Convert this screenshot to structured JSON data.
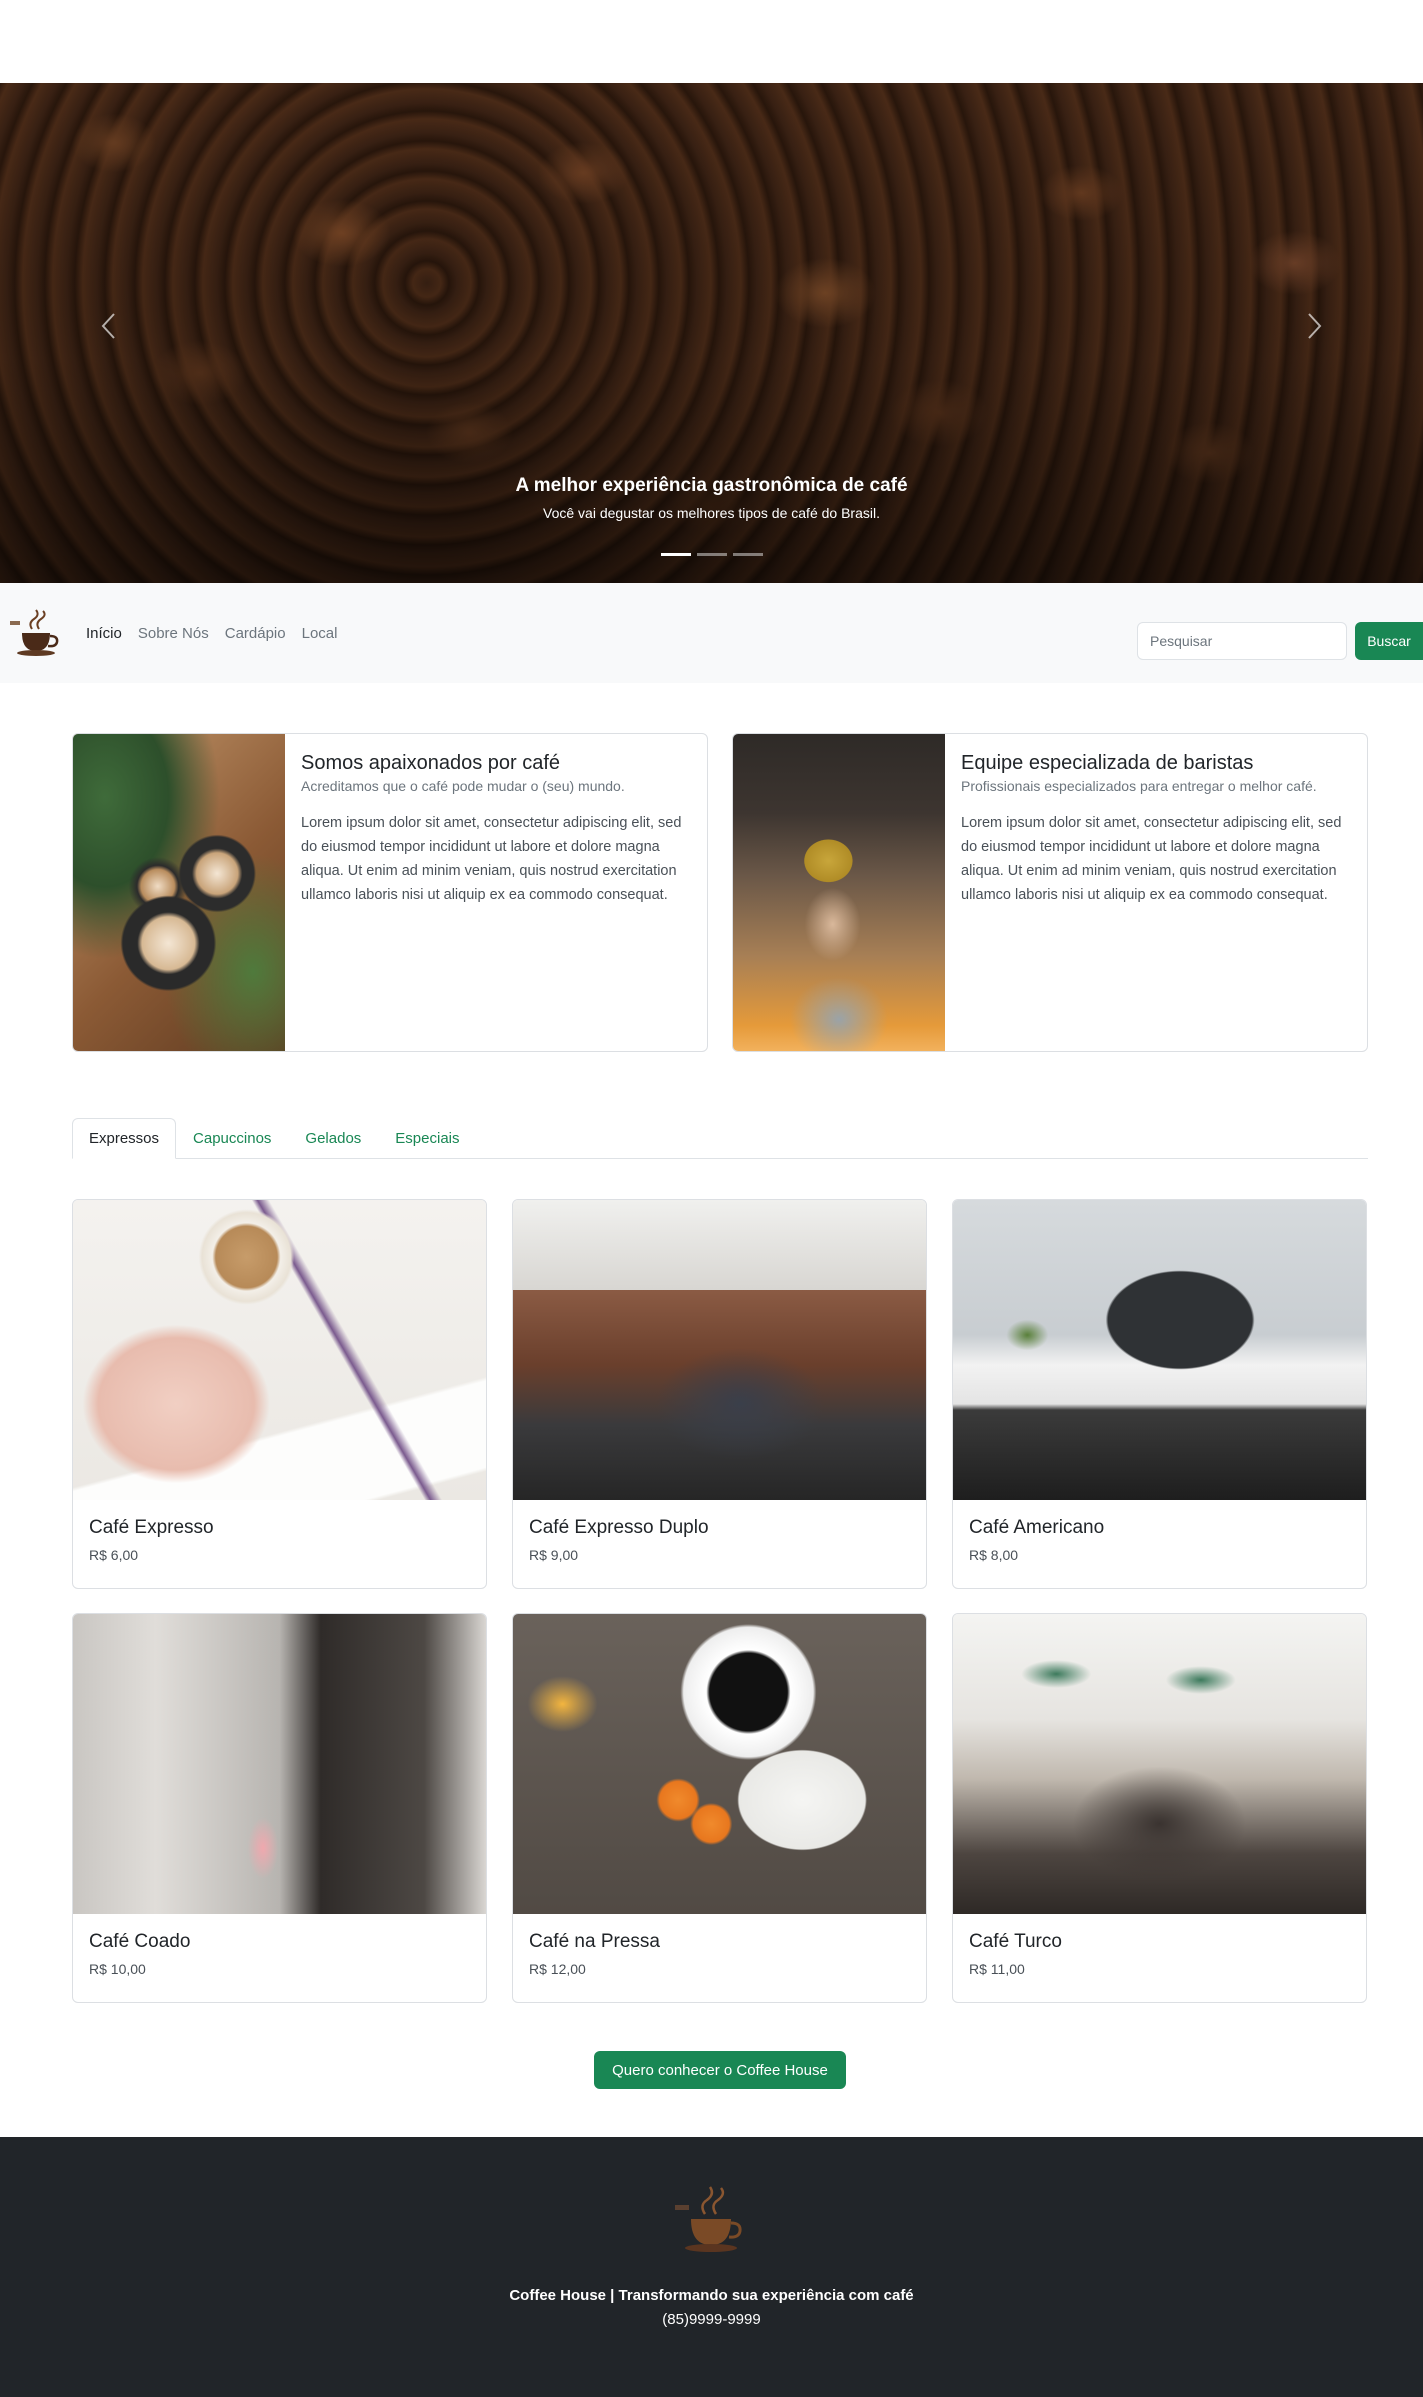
{
  "hero": {
    "title": "A melhor experiência gastronômica de café",
    "subtitle": "Você vai degustar os melhores tipos de café do Brasil.",
    "prev_icon": "chevron-left-icon",
    "next_icon": "chevron-right-icon",
    "slides_count": 3,
    "active_slide": 1
  },
  "navbar": {
    "links": [
      "Início",
      "Sobre Nós",
      "Cardápio",
      "Local"
    ],
    "active_link": "Início",
    "search_placeholder": "Pesquisar",
    "search_button": "Buscar"
  },
  "features": [
    {
      "title": "Somos apaixonados por café",
      "subtitle": "Acreditamos que o café pode mudar o (seu) mundo.",
      "text": "Lorem ipsum dolor sit amet, consectetur adipiscing elit, sed do eiusmod tempor incididunt ut labore et dolore magna aliqua. Ut enim ad minim veniam, quis nostrud exercitation ullamco laboris nisi ut aliquip ex ea commodo consequat."
    },
    {
      "title": "Equipe especializada de baristas",
      "subtitle": "Profissionais especializados para entregar o melhor café.",
      "text": "Lorem ipsum dolor sit amet, consectetur adipiscing elit, sed do eiusmod tempor incididunt ut labore et dolore magna aliqua. Ut enim ad minim veniam, quis nostrud exercitation ullamco laboris nisi ut aliquip ex ea commodo consequat."
    }
  ],
  "tabs": [
    "Expressos",
    "Capuccinos",
    "Gelados",
    "Especiais"
  ],
  "active_tab": "Expressos",
  "products": [
    {
      "name": "Café Expresso",
      "price": "R$ 6,00"
    },
    {
      "name": "Café Expresso Duplo",
      "price": "R$ 9,00"
    },
    {
      "name": "Café Americano",
      "price": "R$ 8,00"
    },
    {
      "name": "Café Coado",
      "price": "R$ 10,00"
    },
    {
      "name": "Café na Pressa",
      "price": "R$ 12,00"
    },
    {
      "name": "Café Turco",
      "price": "R$ 11,00"
    }
  ],
  "cta": {
    "label": "Quero conhecer o Coffee House"
  },
  "footer": {
    "title": "Coffee House | Transformando sua experiência com café",
    "phone": "(85)9999-9999"
  },
  "colors": {
    "primary_green": "#198754",
    "footer_bg": "#212529",
    "navbar_bg": "#f8f9fa"
  }
}
